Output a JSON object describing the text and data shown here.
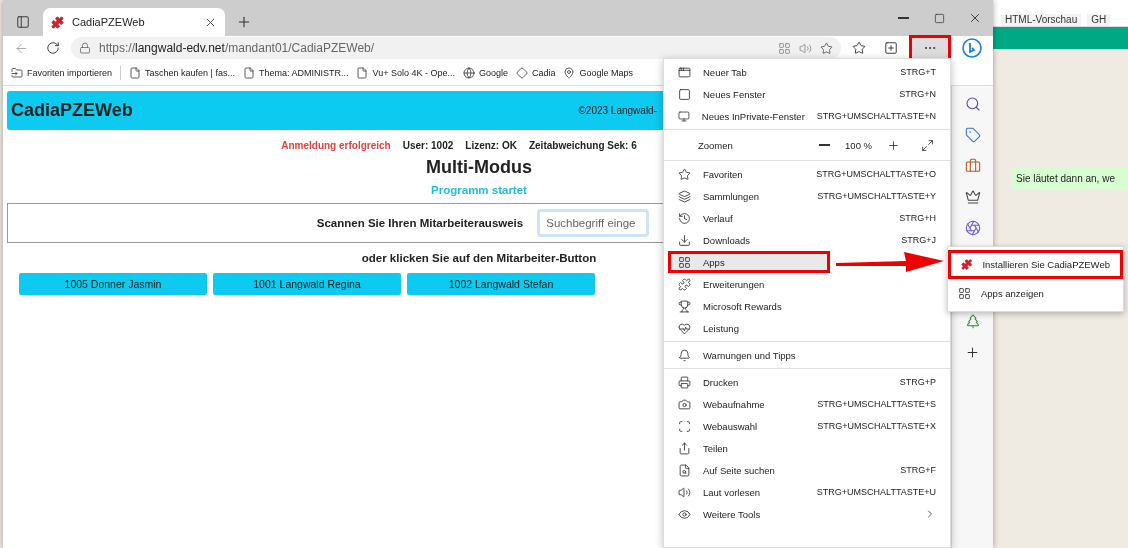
{
  "browser": {
    "tab": {
      "title": "CadiaPZEWeb"
    },
    "url": {
      "scheme": "https://",
      "host": "langwald-edv.net",
      "path": "/mandant01/CadiaPZEWeb/"
    },
    "more_button": {
      "marked": true
    },
    "bookmarks": [
      {
        "label": "Favoriten importieren"
      },
      {
        "label": "Taschen kaufen | fas..."
      },
      {
        "label": "Thema: ADMINISTR..."
      },
      {
        "label": "Vu+ Solo 4K - Ope..."
      },
      {
        "label": "Google"
      },
      {
        "label": "Cadia"
      },
      {
        "label": "Google Maps"
      }
    ]
  },
  "page": {
    "brand": "CadiaPZEWeb",
    "copyright": "©2023 Langwald-",
    "status": [
      {
        "text": "Anmeldung erfolgreich",
        "kind": "alert"
      },
      {
        "text": "User: 1002",
        "kind": "info"
      },
      {
        "text": "Lizenz: OK",
        "kind": "info"
      },
      {
        "text": "Zeitabweichung Sek: 6",
        "kind": "info"
      }
    ],
    "title": "Multi-Modus",
    "message": "Programm startet",
    "scan_label": "Scannen Sie Ihren Mitarbeiterausweis",
    "search": {
      "placeholder": "Suchbegriff einge"
    },
    "hint": "oder klicken Sie auf den Mitarbeiter-Button",
    "employees": [
      "1005 Donner Jasmin",
      "1001 Langwald Regina",
      "1002 Langwald Stefan"
    ]
  },
  "menu": {
    "items": [
      {
        "kind": "item",
        "label": "Neuer Tab",
        "shortcut": "STRG+T",
        "selected": false,
        "marked": false
      },
      {
        "kind": "item",
        "label": "Neues Fenster",
        "shortcut": "STRG+N",
        "selected": false,
        "marked": false
      },
      {
        "kind": "item",
        "label": "Neues InPrivate-Fenster",
        "shortcut": "STRG+UMSCHALTTASTE+N",
        "selected": false,
        "marked": false
      },
      {
        "kind": "separator"
      },
      {
        "kind": "zoom",
        "label": "Zoomen",
        "value": "100 %"
      },
      {
        "kind": "separator"
      },
      {
        "kind": "item",
        "label": "Favoriten",
        "shortcut": "STRG+UMSCHALTTASTE+O",
        "selected": false,
        "marked": false
      },
      {
        "kind": "item",
        "label": "Sammlungen",
        "shortcut": "STRG+UMSCHALTTASTE+Y",
        "selected": false,
        "marked": false
      },
      {
        "kind": "item",
        "label": "Verlauf",
        "shortcut": "STRG+H",
        "selected": false,
        "marked": false
      },
      {
        "kind": "item",
        "label": "Downloads",
        "shortcut": "STRG+J",
        "selected": false,
        "marked": false
      },
      {
        "kind": "item",
        "label": "Apps",
        "selected": true,
        "marked": true
      },
      {
        "kind": "item",
        "label": "Erweiterungen",
        "selected": false,
        "marked": false
      },
      {
        "kind": "item",
        "label": "Microsoft Rewards",
        "selected": false,
        "marked": false
      },
      {
        "kind": "item",
        "label": "Leistung",
        "selected": false,
        "marked": false
      },
      {
        "kind": "separator"
      },
      {
        "kind": "item",
        "label": "Warnungen und Tipps",
        "selected": false,
        "marked": false
      },
      {
        "kind": "separator"
      },
      {
        "kind": "item",
        "label": "Drucken",
        "shortcut": "STRG+P",
        "selected": false,
        "marked": false
      },
      {
        "kind": "item",
        "label": "Webaufnahme",
        "shortcut": "STRG+UMSCHALTTASTE+S",
        "selected": false,
        "marked": false
      },
      {
        "kind": "item",
        "label": "Webauswahl",
        "shortcut": "STRG+UMSCHALTTASTE+X",
        "selected": false,
        "marked": false
      },
      {
        "kind": "item",
        "label": "Teilen",
        "selected": false,
        "marked": false
      },
      {
        "kind": "item",
        "label": "Auf Seite suchen",
        "shortcut": "STRG+F",
        "selected": false,
        "marked": false
      },
      {
        "kind": "item",
        "label": "Laut vorlesen",
        "shortcut": "STRG+UMSCHALTTASTE+U",
        "selected": false,
        "marked": false
      },
      {
        "kind": "submenu",
        "label": "Weitere Tools",
        "selected": false,
        "marked": false
      }
    ]
  },
  "apps_submenu": {
    "items": [
      {
        "label": "Installieren Sie CadiaPZEWeb",
        "marked": true
      },
      {
        "label": "Apps anzeigen",
        "marked": false
      }
    ]
  },
  "background": {
    "tabs": [
      "HTML-Vorschau",
      "GH"
    ],
    "message": "Sie läutet dann an, we"
  }
}
